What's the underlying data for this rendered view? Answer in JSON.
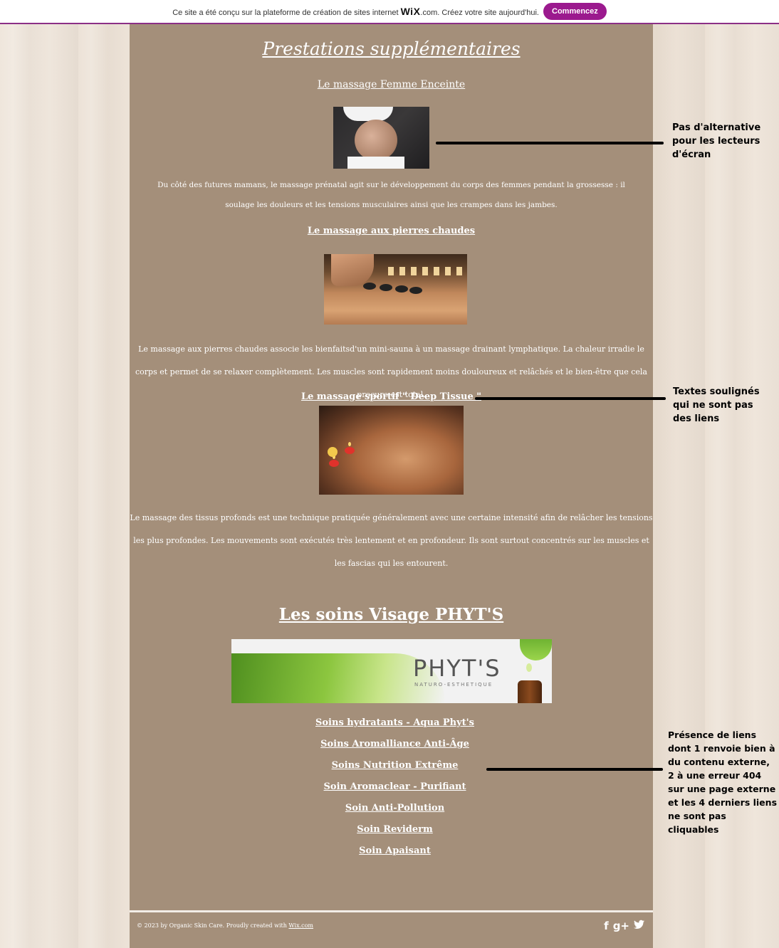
{
  "wix_banner": {
    "text_before": "Ce site a été conçu sur la plateforme de création de sites internet",
    "brand": "WiX",
    "text_after": ".com. Créez votre site aujourd'hui.",
    "cta": "Commencez"
  },
  "page": {
    "title": "Prestations supplémentaires ",
    "massages": [
      {
        "title": "Le massage Femme Enceinte ",
        "description": "Du côté des futures mamans, le massage prénatal agit sur le développement du corps des femmes pendant la grossesse : il soulage les douleurs et les tensions musculaires ainsi que les crampes dans les jambes."
      },
      {
        "title": "Le massage aux pierres chaudes ",
        "description": "Le massage aux pierres chaudes associe les bienfaitsd'un mini-sauna à un massage drainant lymphatique. La chaleur irradie le corps et permet de se relaxer complètement. Les muscles sont rapidement moins douloureux et relâchés et le bien-être que cela procure est total."
      },
      {
        "title": "Le massage sportif \" Deep Tissue \"",
        "description": "Le massage des tissus profonds est une technique pratiquée généralement avec une certaine intensité afin de relâcher les tensions les plus profondes. Les mouvements sont exécutés très lentement et en profondeur. Ils sont surtout concentrés sur les muscles et les fascias qui les entourent."
      }
    ],
    "visage_title": "Les soins Visage PHYT'S",
    "phyts_logo": "PHYT'S",
    "phyts_logo_sub": "NATURO-ESTHETIQUE",
    "soins": [
      "Soins hydratants - Aqua Phyt's",
      "Soins Aromalliance Anti-Âge",
      "Soins Nutrition Extrême ",
      "Soin Aromaclear - Purifiant",
      "Soin Anti-Pollution ",
      "Soin Reviderm ",
      "Soin Apaisant "
    ]
  },
  "footer": {
    "copyright": "© 2023 by Organic Skin Care. Proudly created with ",
    "link": "Wix.com",
    "social": [
      "f",
      "g+",
      "t"
    ]
  },
  "annotations": {
    "a1": "Pas d'alternative pour les lecteurs d'écran",
    "a2": "Textes soulignés qui ne sont pas des liens",
    "a3": "Présence de liens dont 1 renvoie bien à du contenu externe, 2 à une erreur 404 sur une page externe et les 4 derniers liens ne sont pas cliquables"
  }
}
